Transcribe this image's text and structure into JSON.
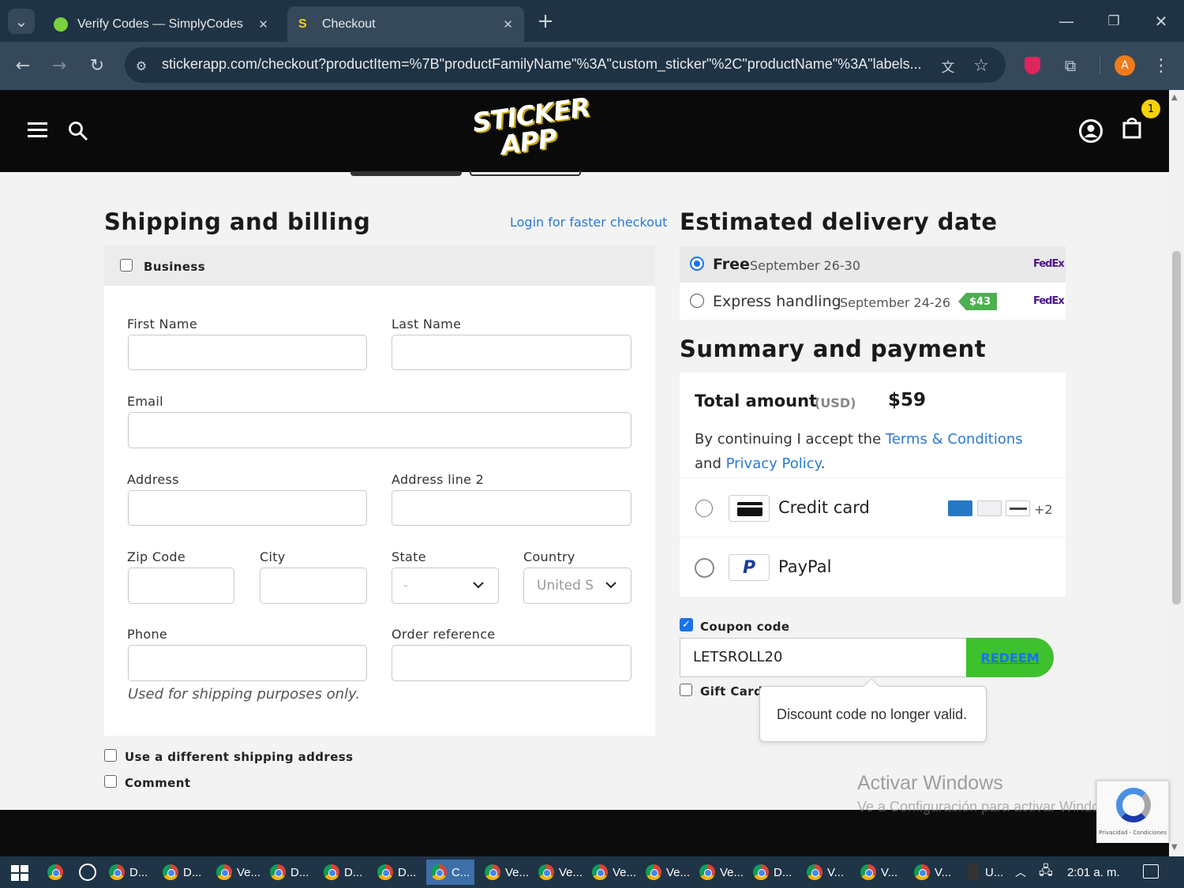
{
  "browser": {
    "tabs": [
      {
        "title": "Verify Codes — SimplyCodes"
      },
      {
        "title": "Checkout"
      }
    ],
    "url": "stickerapp.com/checkout?productItem=%7B\"productFamilyName\"%3A\"custom_sticker\"%2C\"productName\"%3A\"labels..."
  },
  "header": {
    "logo_text_1": "STICKER",
    "logo_text_2": "APP",
    "cart_count": "1"
  },
  "shipping": {
    "title": "Shipping and billing",
    "login_link": "Login for faster checkout",
    "business_label": "Business",
    "first_name_label": "First Name",
    "last_name_label": "Last Name",
    "email_label": "Email",
    "address_label": "Address",
    "address2_label": "Address line 2",
    "zip_label": "Zip Code",
    "city_label": "City",
    "state_label": "State",
    "state_value": "-",
    "country_label": "Country",
    "country_value": "United S",
    "phone_label": "Phone",
    "order_ref_label": "Order reference",
    "phone_hint": "Used for shipping purposes only.",
    "different_address_label": "Use a different shipping address",
    "comment_label": "Comment"
  },
  "delivery": {
    "title": "Estimated delivery date",
    "options": [
      {
        "name": "Free",
        "date": "September 26-30",
        "carrier": "FedEx",
        "selected": true
      },
      {
        "name": "Express handling",
        "date": "September 24-26",
        "price": "$43",
        "carrier": "FedEx",
        "selected": false
      }
    ]
  },
  "summary": {
    "title": "Summary and payment",
    "total_label": "Total amount",
    "currency": "(USD)",
    "total": "$59",
    "accept_prefix": "By continuing I accept the",
    "terms_link": "Terms & Conditions",
    "and": "and",
    "privacy_link": "Privacy Policy",
    "period": ".",
    "payment_methods": [
      {
        "label": "Credit card",
        "extra": "+2"
      },
      {
        "label": "PayPal"
      }
    ]
  },
  "coupon": {
    "label": "Coupon code",
    "checked": true,
    "value": "LETSROLL20",
    "redeem": "REDEEM",
    "gift_card_label": "Gift Card",
    "error": "Discount code no longer valid."
  },
  "watermark": {
    "line1": "Activar Windows",
    "line2": "Ve a Configuración para activar Windows."
  },
  "recaptcha": {
    "text": "Privacidad - Condiciones"
  },
  "taskbar": {
    "items": [
      "D...",
      "D...",
      "Ve...",
      "D...",
      "D...",
      "D...",
      "C...",
      "Ve...",
      "Ve...",
      "Ve...",
      "Ve...",
      "Ve...",
      "D...",
      "V...",
      "V...",
      "V...",
      "U..."
    ],
    "time": "2:01 a. m."
  },
  "colors": {
    "accent_blue": "#2b7ad6",
    "redeem_green": "#3fc12f",
    "badge_yellow": "#f5d20b",
    "fedex_purple": "#4d148c",
    "fedex_orange": "#ff6600"
  }
}
